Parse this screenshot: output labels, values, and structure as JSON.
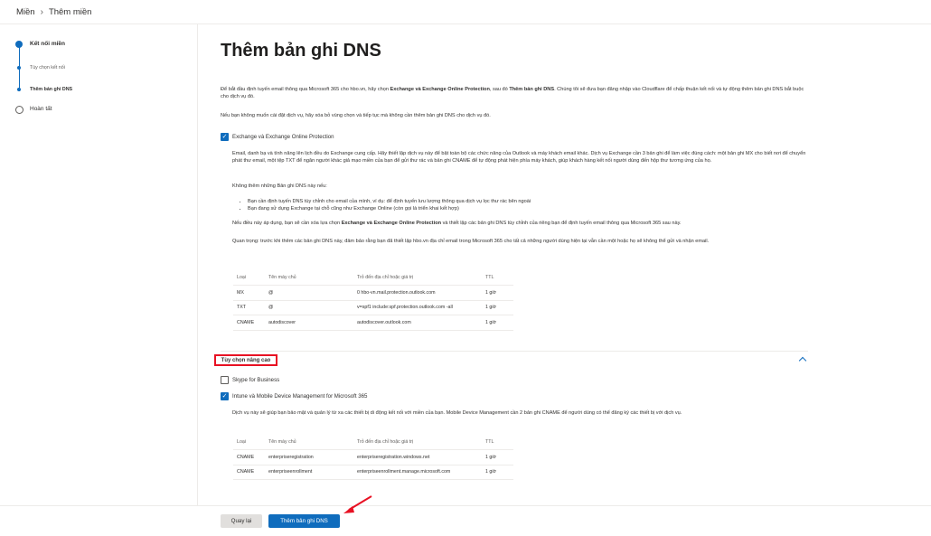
{
  "breadcrumb": {
    "root": "Miền",
    "current": "Thêm miền"
  },
  "steps": [
    {
      "label": "Kết nối miền"
    },
    {
      "label": "Tùy chọn kết nối"
    },
    {
      "label": "Thêm bản ghi DNS"
    },
    {
      "label": "Hoàn tất"
    }
  ],
  "main": {
    "title": "Thêm bản ghi DNS",
    "intro": {
      "p1": "Để bắt đầu định tuyến email thông qua Microsoft 365 cho hbo.vn, hãy chọn ",
      "p1_bold1": "Exchange và Exchange Online Protection",
      "p1_mid": ", sau đó ",
      "p1_bold2": "Thêm bản ghi DNS",
      "p1_end": ". Chúng tôi sẽ đưa bạn đăng nhập vào Cloudflare để chấp thuận kết nối và tự động thêm bản ghi DNS bắt buộc cho dịch vụ đó.",
      "p2": "Nếu bạn không muốn cài đặt dịch vụ, hãy xóa bỏ vùng chọn và tiếp tục mà không cần thêm bản ghi DNS cho dịch vụ đó."
    },
    "exchange": {
      "label": "Exchange và Exchange Online Protection",
      "desc": "Email, danh bạ và tính năng lên lịch đều do Exchange cung cấp. Hãy thiết lập dịch vụ này để bật toàn bộ các chức năng của Outlook và máy khách email khác. Dịch vụ Exchange cần 3 bản ghi để làm việc đúng cách: một bản ghi MX cho biết nơi để chuyển phát thư email, một tệp TXT để ngăn người khác giả mạo miền của bạn để gửi thư rác và bản ghi CNAME để tự động phát hiện phía máy khách, giúp khách hàng kết nối người dùng đến hộp thư tương ứng của họ.",
      "no_add_title": "Không thêm những Bản ghi DNS này nếu:",
      "bullets": [
        "Bạn cần định tuyến DNS tùy chỉnh cho email của mình, ví dụ: để định tuyến lưu lượng thông qua dịch vụ lọc thư rác bên ngoài",
        "Bạn đang sử dụng Exchange tại chỗ cũng như Exchange Online (còn gọi là triển khai kết hợp)"
      ],
      "apply_text_1": "Nếu điều này áp dụng, bạn sẽ cần xóa lựa chọn ",
      "apply_bold": "Exchange và Exchange Online Protection",
      "apply_text_2": " và thiết lập các bản ghi DNS tùy chỉnh của riêng bạn để định tuyến email thông qua Microsoft 365 sau này.",
      "important": "Quan trọng: trước khi thêm các bản ghi DNS này, đảm bảo rằng bạn đã thiết lập hbo.vn địa chỉ email trong Microsoft 365 cho tất cả những người dùng hiện tại vẫn cần một hoặc họ sẽ không thể gửi và nhận email."
    },
    "table1": {
      "headers": [
        "Loại",
        "Tên máy chủ",
        "Trỏ đến địa chỉ hoặc giá trị",
        "TTL"
      ],
      "rows": [
        [
          "MX",
          "@",
          "0 hbo-vn.mail.protection.outlook.com",
          "1 giờ"
        ],
        [
          "TXT",
          "@",
          "v=spf1 include:spf.protection.outlook.com -all",
          "1 giờ"
        ],
        [
          "CNAME",
          "autodiscover",
          "autodiscover.outlook.com",
          "1 giờ"
        ]
      ]
    },
    "advanced": {
      "title": "Tùy chọn nâng cao",
      "skype_label": "Skype for Business",
      "intune_label": "Intune và Mobile Device Management for Microsoft 365",
      "intune_desc": "Dịch vụ này sẽ giúp bạn bảo mật và quản lý từ xa các thiết bị di động kết nối với miền của bạn. Mobile Device Management cần 2 bản ghi CNAME để người dùng có thể đăng ký các thiết bị với dịch vụ."
    },
    "table2": {
      "headers": [
        "Loại",
        "Tên máy chủ",
        "Trỏ đến địa chỉ hoặc giá trị",
        "TTL"
      ],
      "rows": [
        [
          "CNAME",
          "enterpriseregistration",
          "enterpriseregistration.windows.net",
          "1 giờ"
        ],
        [
          "CNAME",
          "enterpriseenrollment",
          "enterpriseenrollment.manage.microsoft.com",
          "1 giờ"
        ]
      ]
    }
  },
  "footer": {
    "back_label": "Quay lại",
    "primary_label": "Thêm bản ghi DNS"
  },
  "colors": {
    "accent": "#0f6cbd",
    "highlight": "#e81123"
  }
}
